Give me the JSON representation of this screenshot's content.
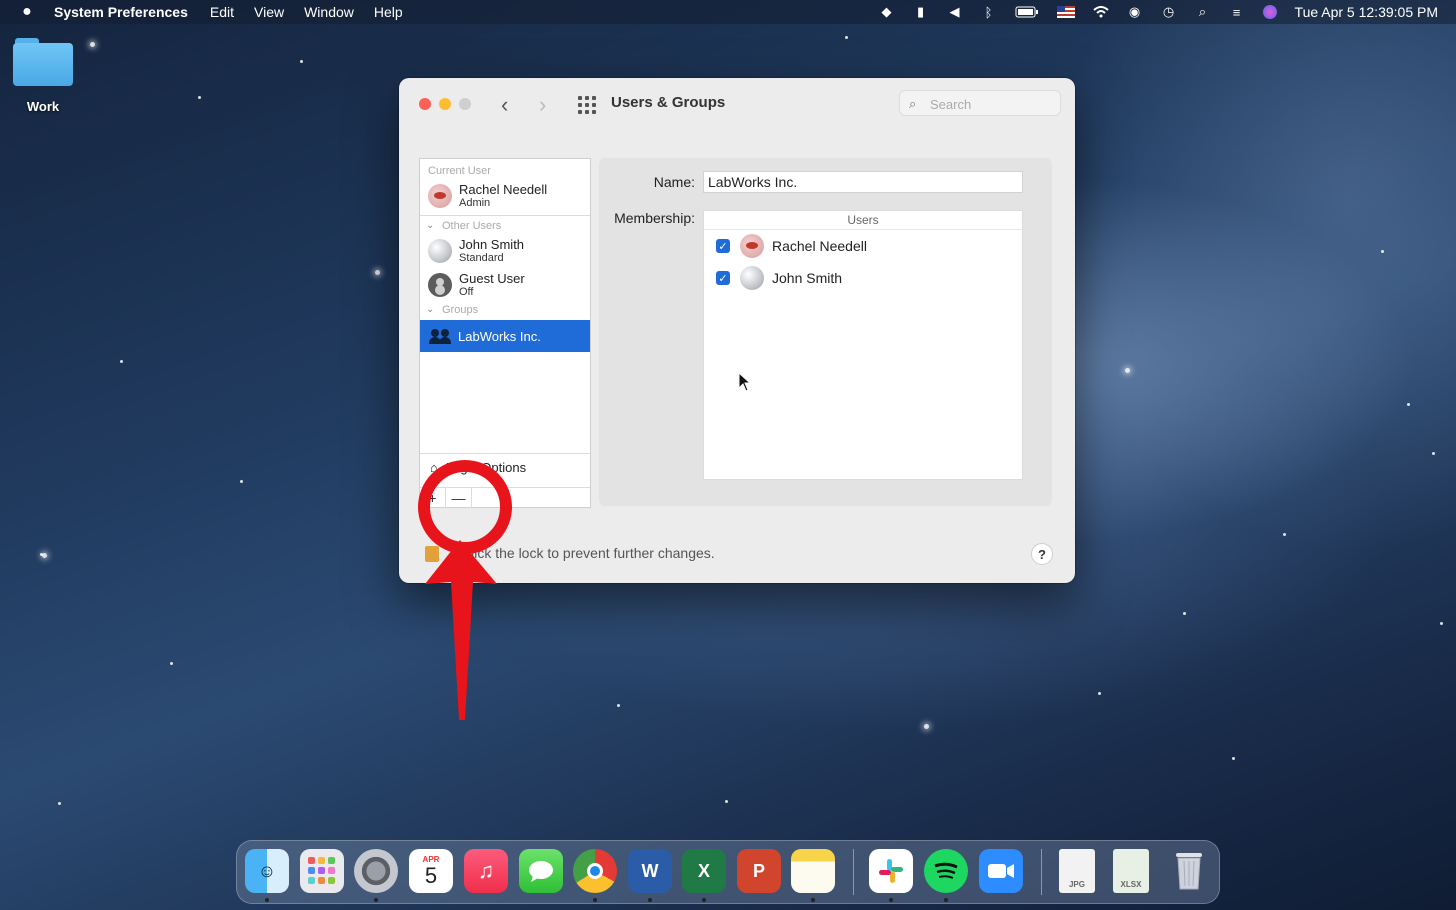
{
  "menubar": {
    "app_name": "System Preferences",
    "menus": [
      "Edit",
      "View",
      "Window",
      "Help"
    ],
    "clock": "Tue Apr 5  12:39:05 PM"
  },
  "desktop": {
    "folder_label": "Work"
  },
  "window": {
    "title": "Users & Groups",
    "search_placeholder": "Search",
    "sidebar": {
      "current_user_header": "Current User",
      "current_user": {
        "name": "Rachel Needell",
        "role": "Admin"
      },
      "other_users_header": "Other Users",
      "other_users": [
        {
          "name": "John Smith",
          "role": "Standard"
        },
        {
          "name": "Guest User",
          "role": "Off"
        }
      ],
      "groups_header": "Groups",
      "groups": [
        {
          "name": "LabWorks Inc.",
          "selected": true
        }
      ],
      "login_options": "Login Options",
      "add_label": "+",
      "remove_label": "—"
    },
    "panel": {
      "name_label": "Name:",
      "name_value": "LabWorks Inc.",
      "membership_label": "Membership:",
      "members_header": "Users",
      "members": [
        {
          "name": "Rachel Needell",
          "checked": true
        },
        {
          "name": "John Smith",
          "checked": true
        }
      ]
    },
    "lock_text": "Click the lock to prevent further changes.",
    "help_label": "?"
  },
  "dock": {
    "calendar_month": "APR",
    "calendar_day": "5",
    "word_letter": "W",
    "excel_letter": "X",
    "ppt_letter": "P",
    "file_jpg_label": "JPG",
    "file_xlsx_label": "XLSX"
  },
  "colors": {
    "accent": "#1f6cd9",
    "annotation": "#e8141c"
  }
}
